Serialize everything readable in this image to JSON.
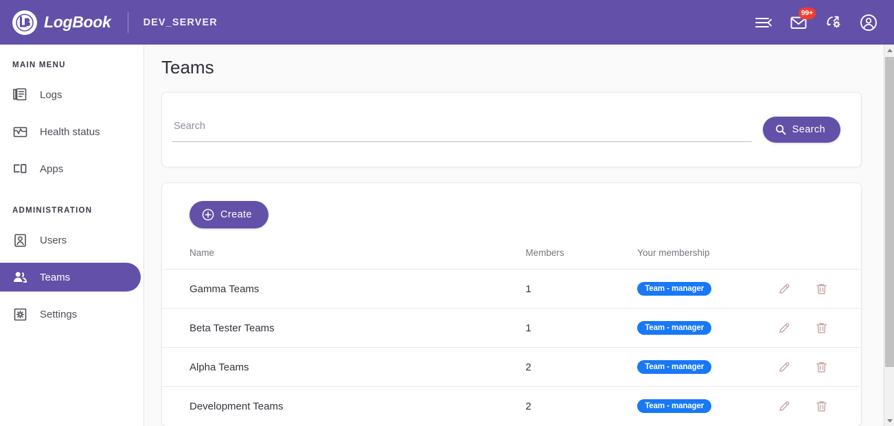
{
  "topbar": {
    "brand_name": "LogBook",
    "server_name": "DEV_SERVER",
    "logo_icon": "logbook-lb-monogram",
    "actions": [
      {
        "name": "collapse-menu-icon",
        "label": ""
      },
      {
        "name": "messages-icon",
        "label": "",
        "badge": "99+"
      },
      {
        "name": "sync-settings-icon",
        "label": ""
      },
      {
        "name": "account-icon",
        "label": ""
      }
    ]
  },
  "sidebar": {
    "sections": [
      {
        "title": "MAIN MENU",
        "items": [
          {
            "label": "Logs",
            "icon": "logs-icon",
            "active": false
          },
          {
            "label": "Health status",
            "icon": "health-status-icon",
            "active": false
          },
          {
            "label": "Apps",
            "icon": "apps-icon",
            "active": false
          }
        ]
      },
      {
        "title": "ADMINISTRATION",
        "items": [
          {
            "label": "Users",
            "icon": "users-icon",
            "active": false
          },
          {
            "label": "Teams",
            "icon": "teams-icon",
            "active": true
          },
          {
            "label": "Settings",
            "icon": "settings-icon",
            "active": false
          }
        ]
      }
    ]
  },
  "main": {
    "page_title": "Teams",
    "search": {
      "placeholder": "Search",
      "value": "",
      "button_label": "Search",
      "button_icon": "search-icon"
    },
    "create_button": {
      "label": "Create",
      "icon": "plus-circle-icon"
    },
    "table": {
      "headers": [
        "Name",
        "Members",
        "Your membership"
      ],
      "rows": [
        {
          "name": "Gamma Teams",
          "members": "1",
          "membership": "Team - manager"
        },
        {
          "name": "Beta Tester Teams",
          "members": "1",
          "membership": "Team - manager"
        },
        {
          "name": "Alpha Teams",
          "members": "2",
          "membership": "Team - manager"
        },
        {
          "name": "Development Teams",
          "members": "2",
          "membership": "Team - manager"
        }
      ],
      "row_actions": [
        {
          "name": "edit-icon",
          "title": "Edit"
        },
        {
          "name": "delete-icon",
          "title": "Delete"
        }
      ]
    }
  },
  "colors": {
    "brand_purple": "#6350a8",
    "badge_blue": "#1878f6",
    "notification_red": "#f33d2e",
    "page_background": "#fafafa"
  }
}
